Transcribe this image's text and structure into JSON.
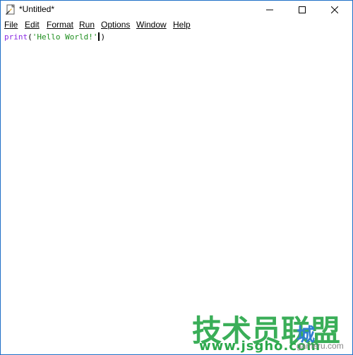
{
  "window": {
    "title": "*Untitled*"
  },
  "menu": [
    {
      "key": "F",
      "rest": "ile"
    },
    {
      "key": "E",
      "rest": "dit"
    },
    {
      "key": "F",
      "rest": "ormat"
    },
    {
      "key": "R",
      "rest": "un"
    },
    {
      "key": "O",
      "rest": "ptions"
    },
    {
      "key": "W",
      "rest": "indow"
    },
    {
      "key": "H",
      "rest": "elp"
    }
  ],
  "editor": {
    "code_keyword": "print",
    "code_open": "(",
    "code_string": "'Hello World!'",
    "code_close": ")"
  },
  "watermark": {
    "main": "技术员联盟",
    "url": "www.jsgho.com",
    "badge": "城",
    "gray": "gameru.com"
  },
  "colors": {
    "keyword": "#8a2be2",
    "string": "#1f8f1f",
    "watermark_green": "#2aa84a",
    "border": "#1e6fc7"
  },
  "icons": {
    "app": "idle-app-icon",
    "minimize": "minimize-icon",
    "maximize": "maximize-icon",
    "close": "close-icon"
  }
}
